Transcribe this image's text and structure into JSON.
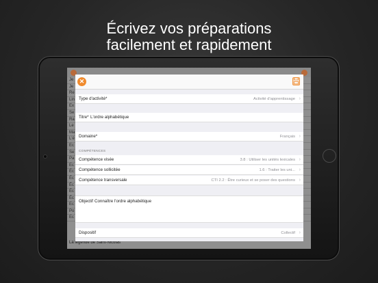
{
  "headline": {
    "line1": "Écrivez vos préparations",
    "line2": "facilement et rapidement"
  },
  "background_list": {
    "rows": [
      "Je",
      "Je",
      "Re",
      "Lin",
      "Ex",
      "Se",
      "Ra",
      "Le",
      "Ma",
      "L'é",
      "Ec",
      "Se",
      "Pa",
      "Ec",
      "Éc",
      "Éc",
      "Éc",
      "Éc",
      "Éc",
      "Ec",
      "Po",
      "Ec"
    ],
    "last_row": "La légende de Saint-Nicolas"
  },
  "form": {
    "colors": {
      "accent": "#f08b2e"
    },
    "header": {
      "close_icon": "close-icon",
      "save_icon": "save-icon"
    },
    "type_activite": {
      "label": "Type d'activité*",
      "value": "Activité d'apprentissage"
    },
    "titre": {
      "label": "Titre*",
      "value": "L'ordre alphabétique"
    },
    "domaine": {
      "label": "Domaine*",
      "value": "Français"
    },
    "section_competences": "COMPÉTENCES",
    "competence_visee": {
      "label": "Compétence visée",
      "value": "3.8 : Utiliser les unités lexicales"
    },
    "competence_sollicitee": {
      "label": "Compétence sollicitée",
      "value": "1.6 : Traiter les uni..."
    },
    "competence_transversale": {
      "label": "Compétence transversale",
      "value": "CTI 2.2 : Être curieux et se poser des questions"
    },
    "objectif": {
      "label": "Objectif",
      "value": "Connaître l'ordre alphabétique"
    },
    "dispositif": {
      "label": "Dispositif",
      "value": "Collectif"
    },
    "chevron": "›"
  }
}
